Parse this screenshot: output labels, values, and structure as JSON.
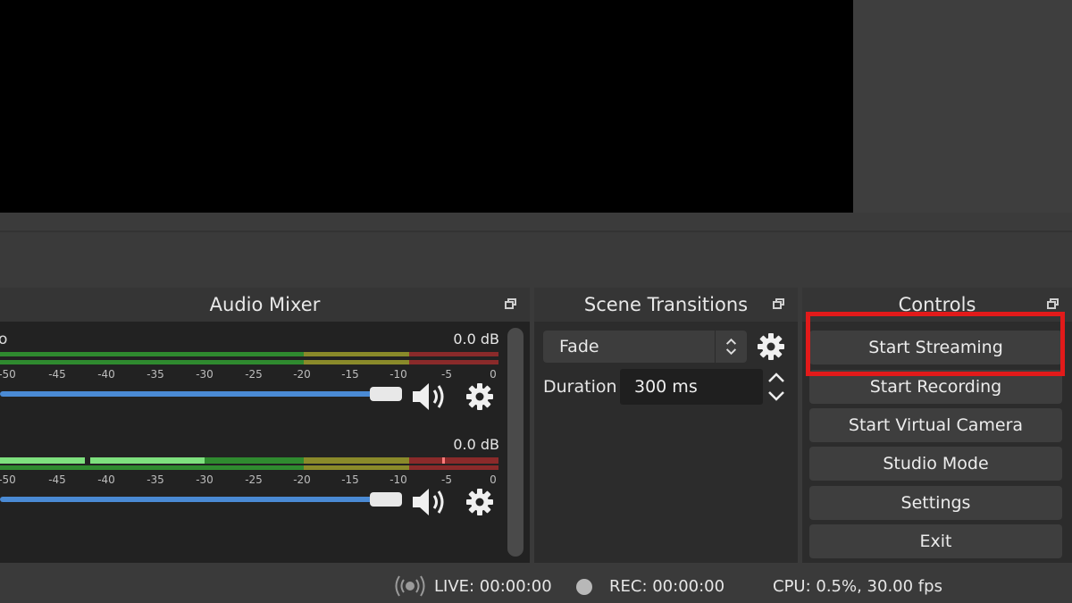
{
  "audio_mixer": {
    "title": "Audio Mixer",
    "channels": [
      {
        "name": "o",
        "db": "0.0 dB"
      },
      {
        "name": "",
        "db": "0.0 dB"
      }
    ],
    "tick_labels": [
      "-50",
      "-45",
      "-40",
      "-35",
      "-30",
      "-25",
      "-20",
      "-15",
      "-10",
      "-5",
      "0"
    ]
  },
  "scene_transitions": {
    "title": "Scene Transitions",
    "transition": "Fade",
    "duration_label": "Duration",
    "duration_value": "300 ms"
  },
  "controls": {
    "title": "Controls",
    "buttons": [
      "Start Streaming",
      "Start Recording",
      "Start Virtual Camera",
      "Studio Mode",
      "Settings",
      "Exit"
    ]
  },
  "status": {
    "live": "LIVE: 00:00:00",
    "rec": "REC: 00:00:00",
    "cpu": "CPU: 0.5%, 30.00 fps"
  },
  "colors": {
    "highlight": "#e21a1a",
    "slider": "#4a8ad4",
    "meter_green": "#2f8a2f",
    "meter_yellow": "#8a8a2a",
    "meter_red": "#8a2a2a"
  }
}
